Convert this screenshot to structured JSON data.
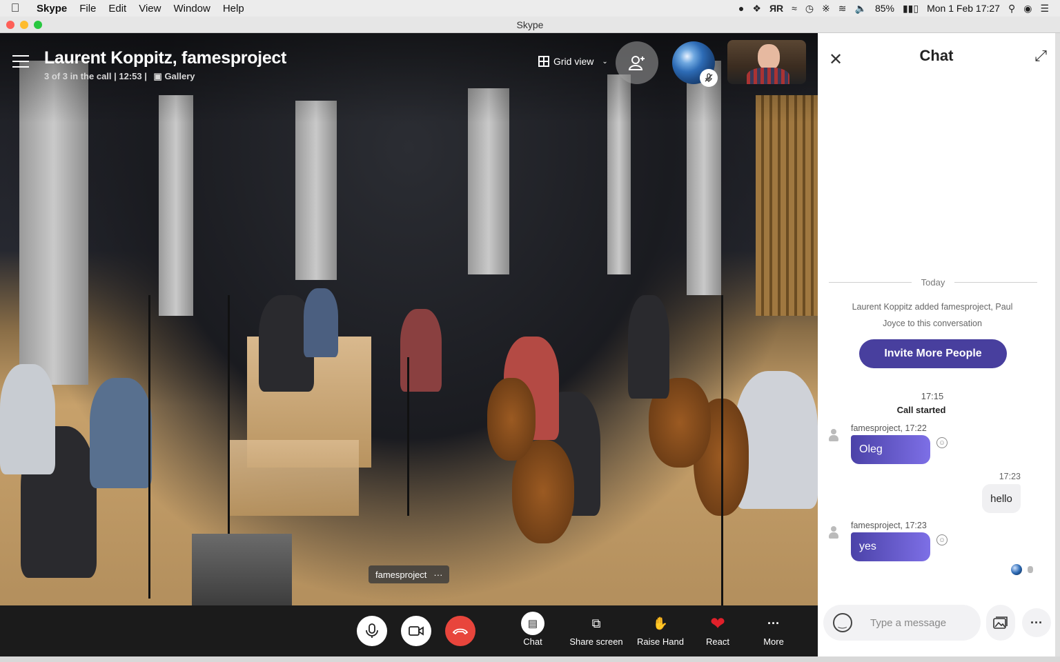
{
  "menubar": {
    "app_name": "Skype",
    "items": [
      "File",
      "Edit",
      "View",
      "Window",
      "Help"
    ],
    "battery": "85%",
    "datetime": "Mon 1 Feb  17:27",
    "tray_icons": [
      "skype-tray-icon",
      "dropbox-icon",
      "readiris-icon",
      "wifi-alt-icon",
      "time-machine-icon",
      "bluetooth-icon",
      "wifi-icon",
      "volume-icon",
      "battery-icon",
      "search-icon",
      "siri-icon",
      "list-icon"
    ]
  },
  "window": {
    "title": "Skype"
  },
  "call": {
    "title": "Laurent Koppitz, famesproject",
    "subtitle": "3 of 3 in the call | 12:53 |",
    "view_mode": "Gallery",
    "grid_view_label": "Grid view",
    "participant_tag": "famesproject",
    "participant_tag_menu": "···"
  },
  "controls": {
    "chat_label": "Chat",
    "share_label": "Share screen",
    "raise_label": "Raise Hand",
    "react_label": "React",
    "more_label": "More",
    "colors": {
      "end_call": "#e8453c",
      "react_heart": "#e0202a"
    }
  },
  "chat": {
    "title": "Chat",
    "day_divider": "Today",
    "system_message": "Laurent Koppitz added famesproject, Paul Joyce to this conversation",
    "invite_label": "Invite More People",
    "call_time": "17:15",
    "call_started": "Call started",
    "messages": [
      {
        "sender": "famesproject, 17:22",
        "text": "Oleg",
        "direction": "in"
      },
      {
        "time": "17:23",
        "text": "hello",
        "direction": "out"
      },
      {
        "sender": "famesproject, 17:23",
        "text": "yes",
        "direction": "in"
      }
    ],
    "input_placeholder": "Type a message",
    "accent_color": "#483f9e"
  }
}
